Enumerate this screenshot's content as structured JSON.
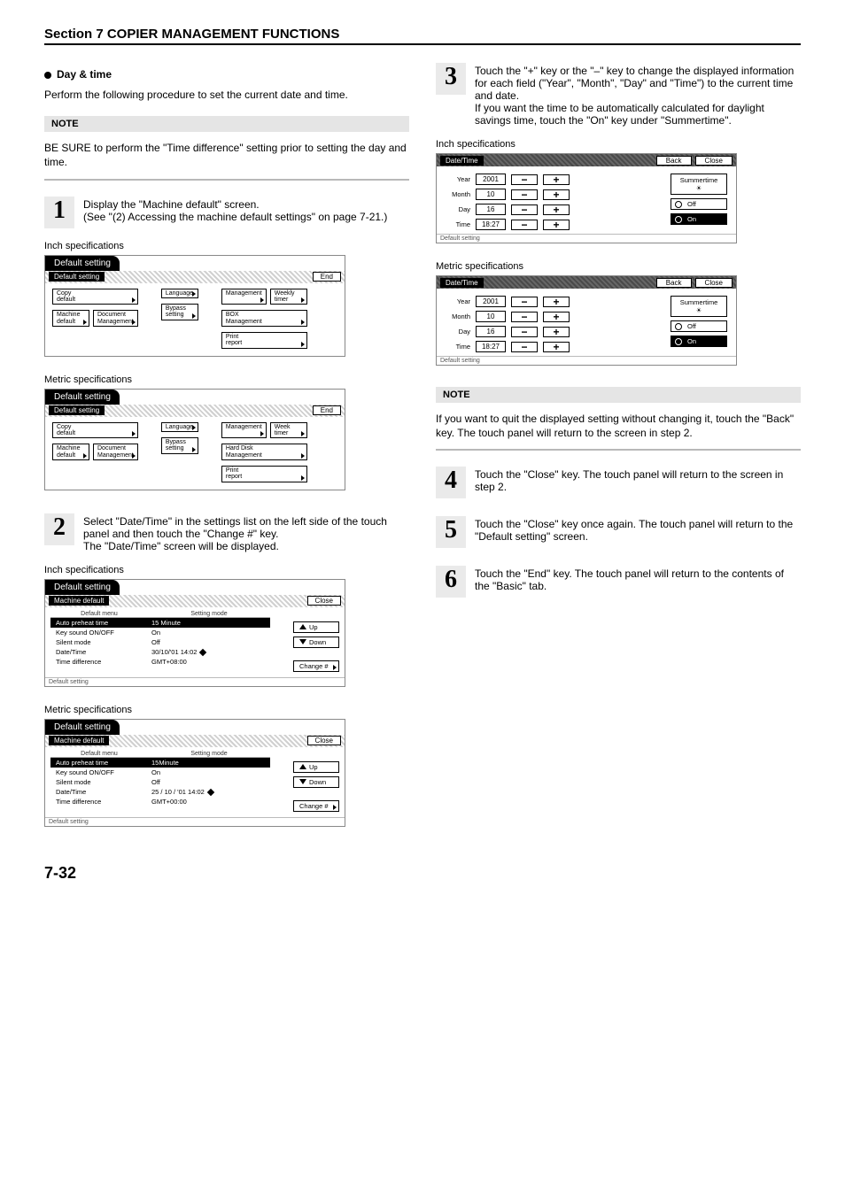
{
  "section_title": "Section 7  COPIER MANAGEMENT FUNCTIONS",
  "heading": "Day & time",
  "intro": "Perform the following procedure to set the current date and time.",
  "note_label": "NOTE",
  "note1": "BE SURE to perform the \"Time difference\" setting prior to setting the day and time.",
  "note2": "If you want to quit the displayed setting without changing it, touch the \"Back\" key. The touch panel will return to the screen in step 2.",
  "steps": {
    "1": "Display the \"Machine default\" screen.\n(See \"(2) Accessing the machine default settings\" on page 7-21.)",
    "2": "Select \"Date/Time\" in the settings list on the left side of the touch panel and then touch the \"Change #\" key.\nThe \"Date/Time\" screen will be displayed.",
    "3": "Touch the \"+\" key or the \"–\" key to change the displayed information for each field (\"Year\", \"Month\", \"Day\" and \"Time\") to the current time and date.\nIf you want the time to be automatically calculated for daylight savings time, touch the \"On\" key under \"Summertime\".",
    "4": "Touch the \"Close\" key. The touch panel will return to the screen in step 2.",
    "5": "Touch the \"Close\" key once again. The touch panel will return to the \"Default setting\" screen.",
    "6": "Touch the \"End\" key. The touch panel will return to the contents of the \"Basic\" tab."
  },
  "spec_inch": "Inch specifications",
  "spec_metric": "Metric specifications",
  "panel_default": {
    "tab": "Default setting",
    "bar": "Default setting",
    "end": "End",
    "footer": "",
    "chips_inch": {
      "c1a": "Copy\ndefault",
      "c1b": "Machine\ndefault",
      "c1c": "Document\nManagement",
      "c2a": "Language",
      "c2b": "Bypass\nsetting",
      "c3a": "Management",
      "c3a2": "Weekly\ntimer",
      "c3b": "BOX\nManagement",
      "c3c": "Print\nreport"
    },
    "chips_metric": {
      "c1a": "Copy\ndefault",
      "c1b": "Machine\ndefault",
      "c1c": "Document\nManagement",
      "c2a": "Language",
      "c2b": "Bypass\nsetting",
      "c3a": "Management",
      "c3a2": "Week\ntimer",
      "c3b": "Hard Disk\nManagement",
      "c3c": "Print\nreport"
    }
  },
  "mlist": {
    "tab": "Default setting",
    "bar": "Machine default",
    "close": "Close",
    "head_l": "Default menu",
    "head_r": "Setting mode",
    "up": "Up",
    "down": "Down",
    "change": "Change #",
    "footer": "Default setting",
    "rows_inch": [
      {
        "l": "Auto preheat time",
        "r": "15 Minute",
        "sel": true
      },
      {
        "l": "Key sound ON/OFF",
        "r": "On"
      },
      {
        "l": "Silent mode",
        "r": "Off"
      },
      {
        "l": "Date/Time",
        "r": "30/10/'01 14:02",
        "d": true
      },
      {
        "l": "Time difference",
        "r": "GMT+08:00"
      }
    ],
    "rows_metric": [
      {
        "l": "Auto preheat time",
        "r": "15Minute",
        "sel": true
      },
      {
        "l": "Key sound ON/OFF",
        "r": "On"
      },
      {
        "l": "Silent mode",
        "r": "Off"
      },
      {
        "l": "Date/Time",
        "r": "25 / 10 / '01 14:02",
        "d": true
      },
      {
        "l": "Time difference",
        "r": "GMT+00:00"
      }
    ]
  },
  "dt": {
    "bar": "Date/Time",
    "back": "Back",
    "close": "Close",
    "year_l": "Year",
    "year_v": "2001",
    "month_l": "Month",
    "month_v": "10",
    "day_l": "Day",
    "day_v": "16",
    "time_l": "Time",
    "time_v": "18:27",
    "summer": "Summertime",
    "off": "Off",
    "on": "On",
    "footer": "Default setting"
  },
  "page_num": "7-32"
}
